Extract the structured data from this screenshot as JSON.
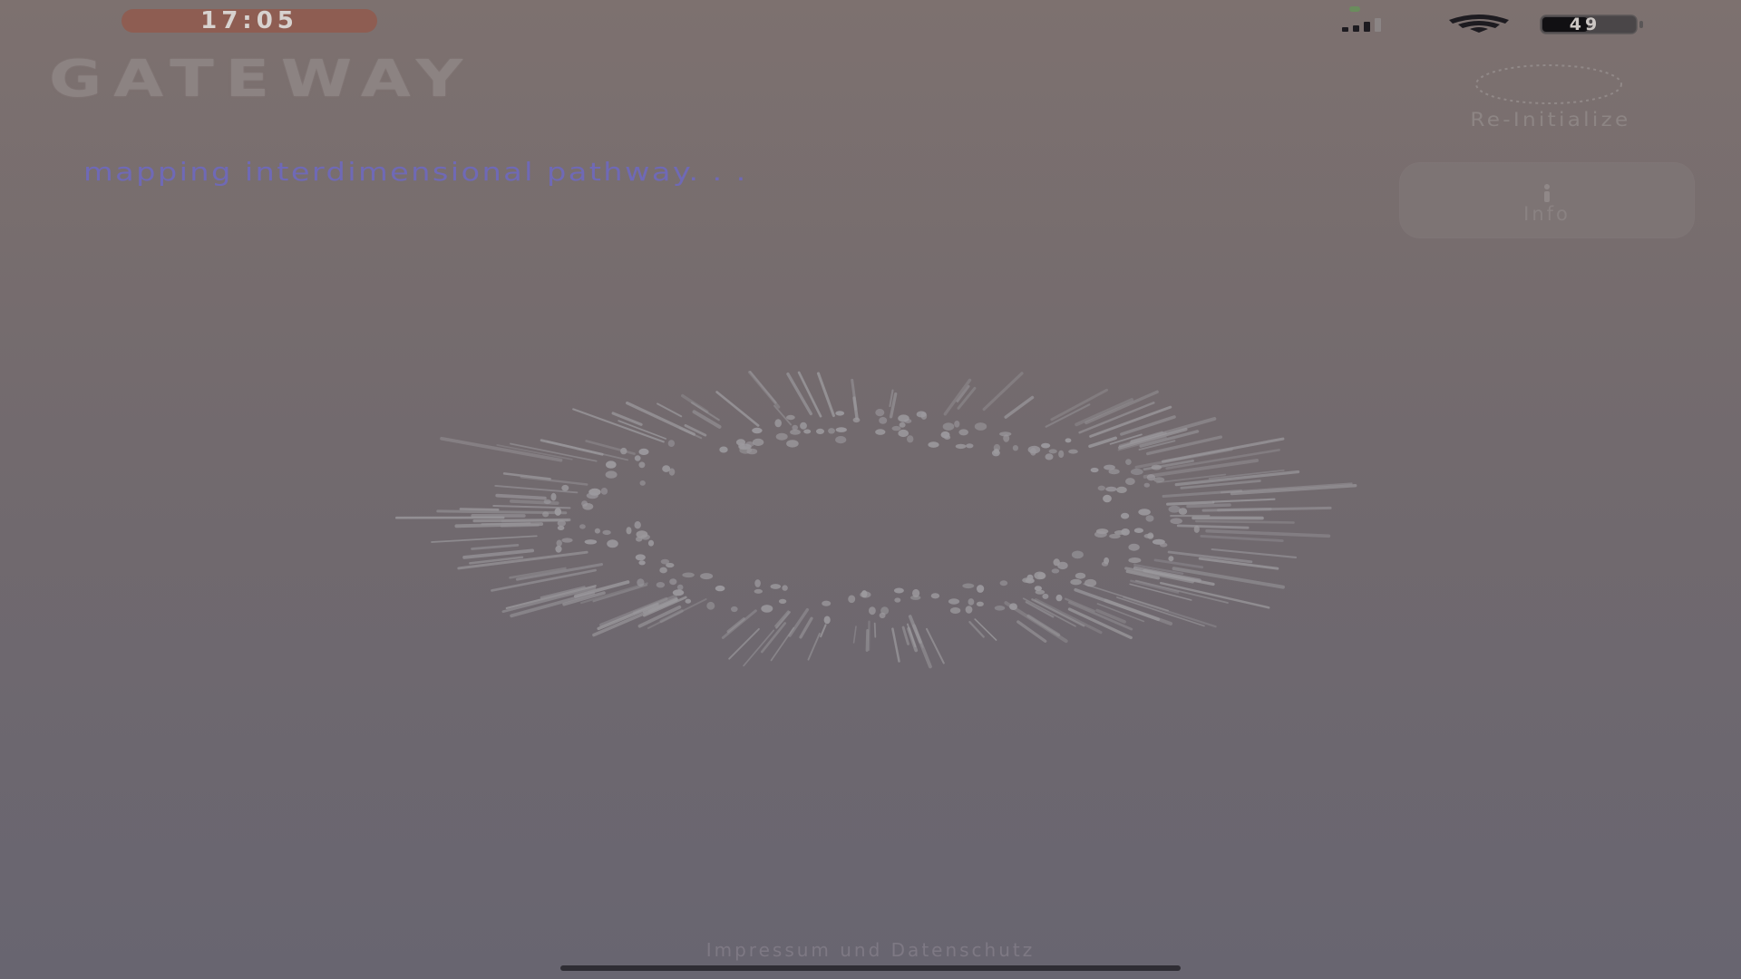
{
  "status_bar": {
    "time": "17:05",
    "battery_percent": "49",
    "signal_icon": "cellular-signal-icon",
    "wifi_icon": "wifi-icon",
    "battery_icon": "battery-icon"
  },
  "header": {
    "title": "GATEWAY",
    "status_text": "mapping interdimensional pathway. . ."
  },
  "controls": {
    "reinitialize_label": "Re-Initialize",
    "reinitialize_icon": "dashed-ring-icon",
    "info_label": "Info",
    "info_icon": "info-icon"
  },
  "visual": {
    "icon": "particle-ring"
  },
  "footer": {
    "link_text": "Impressum und Datenschutz"
  },
  "colors": {
    "background_top": "#7d716f",
    "background_bottom": "#686570",
    "time_pill": "#8e5d52",
    "status_text": "#6f69b6",
    "particles": "#9c9a9e"
  }
}
